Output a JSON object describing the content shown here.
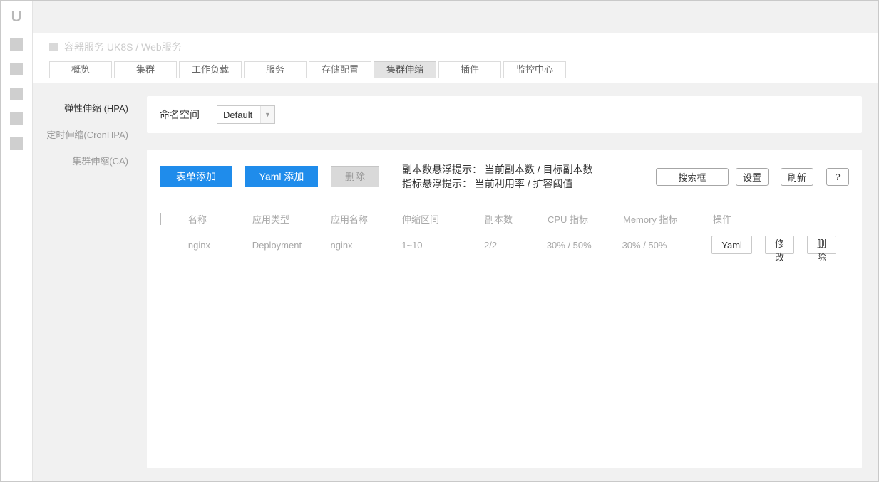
{
  "colors": {
    "accent": "#1f8ceb",
    "tab_active_bg": "#e3e3e3"
  },
  "rail": {
    "logo": "U"
  },
  "breadcrumb": {
    "text": "容器服务 UK8S / Web服务"
  },
  "tabs": [
    {
      "label": "概览"
    },
    {
      "label": "集群"
    },
    {
      "label": "工作负载"
    },
    {
      "label": "服务"
    },
    {
      "label": "存储配置"
    },
    {
      "label": "集群伸缩",
      "active": true
    },
    {
      "label": "插件"
    },
    {
      "label": "监控中心"
    }
  ],
  "sidebar": {
    "items": [
      {
        "label": "弹性伸缩 (HPA)",
        "active": true
      },
      {
        "label": "定时伸缩(CronHPA)"
      },
      {
        "label": "集群伸缩(CA)"
      }
    ]
  },
  "filter": {
    "namespace_label": "命名空间",
    "namespace_value": "Default"
  },
  "toolbar": {
    "form_add": "表单添加",
    "yaml_add": "Yaml 添加",
    "delete": "删除",
    "hint_line1": "副本数悬浮提示： 当前副本数 / 目标副本数",
    "hint_line2": "指标悬浮提示： 当前利用率 / 扩容阈值",
    "search": "搜索框",
    "settings": "设置",
    "refresh": "刷新",
    "help": "?"
  },
  "table": {
    "headers": [
      "名称",
      "应用类型",
      "应用名称",
      "伸缩区间",
      "副本数",
      "CPU 指标",
      "Memory 指标",
      "操作"
    ],
    "rows": [
      {
        "name": "nginx",
        "type": "Deployment",
        "app_name": "nginx",
        "range": "1~10",
        "replicas": "2/2",
        "cpu": "30% / 50%",
        "memory": "30% / 50%",
        "actions": [
          "Yaml",
          "修改",
          "删除"
        ]
      }
    ]
  }
}
